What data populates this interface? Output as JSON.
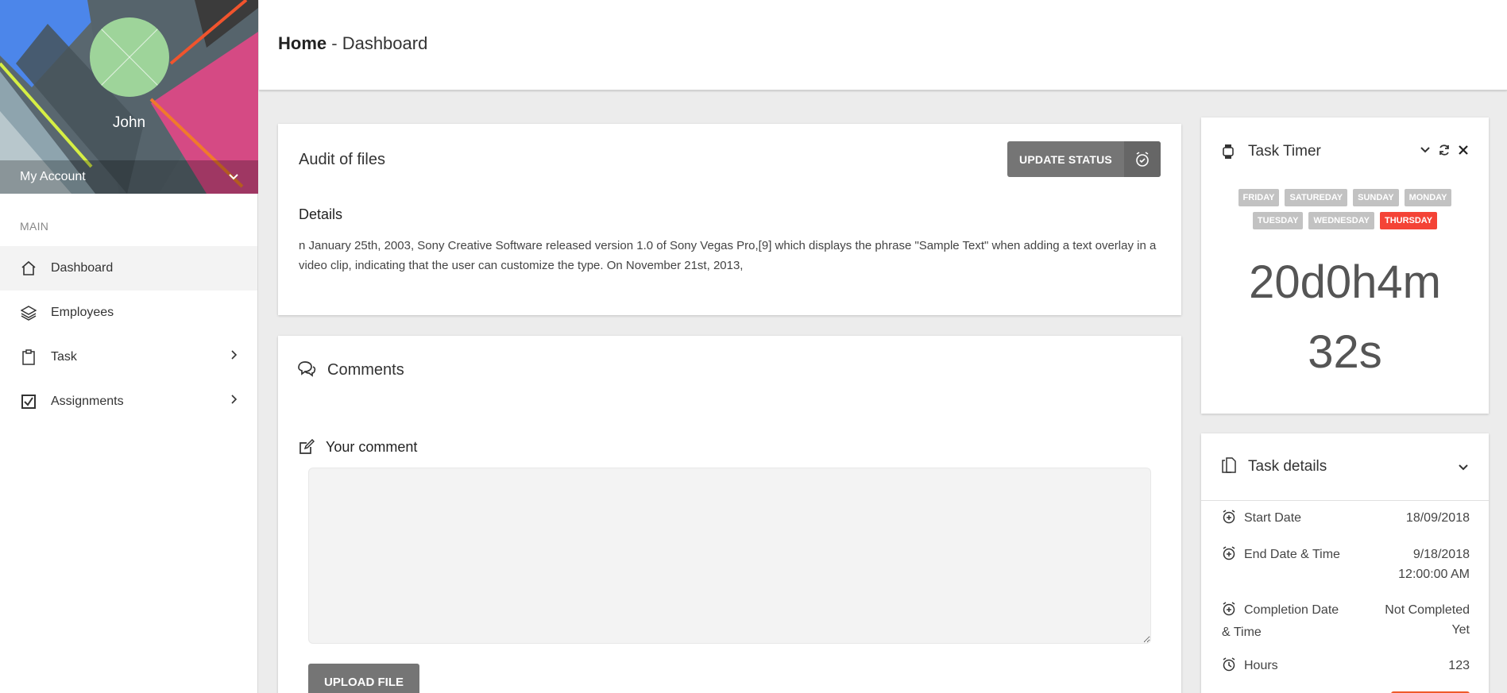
{
  "sidebar": {
    "user_name": "John",
    "account_label": "My Account",
    "section_label": "MAIN",
    "items": [
      {
        "label": "Dashboard"
      },
      {
        "label": "Employees"
      },
      {
        "label": "Task"
      },
      {
        "label": "Assignments"
      }
    ]
  },
  "header": {
    "home": "Home",
    "separator": "-",
    "page": "Dashboard"
  },
  "audit": {
    "title": "Audit of files",
    "update_button": "UPDATE STATUS",
    "details_heading": "Details",
    "details_text": "n January 25th, 2003, Sony Creative Software released version 1.0 of Sony Vegas Pro,[9] which displays the phrase \"Sample Text\" when adding a text overlay in a video clip, indicating that the user can customize the type. On November 21st, 2013,"
  },
  "comments": {
    "title": "Comments",
    "your_comment": "Your comment",
    "textarea_value": "",
    "upload_button": "UPLOAD FILE"
  },
  "timer": {
    "title": "Task Timer",
    "days": [
      "FRIDAY",
      "SATUREDAY",
      "SUNDAY",
      "MONDAY",
      "TUESDAY",
      "WEDNESDAY",
      "THURSDAY"
    ],
    "active_day": "THURSDAY",
    "clock_line1": "20d0h4m",
    "clock_line2": "32s"
  },
  "task_details": {
    "title": "Task details",
    "rows": [
      {
        "label": "Start Date",
        "value": "18/09/2018"
      },
      {
        "label": "End Date & Time",
        "value": "9/18/2018 12:00:00 AM"
      },
      {
        "label": "Completion Date & Time",
        "value": "Not Completed Yet"
      },
      {
        "label": "Hours",
        "value": "123"
      }
    ]
  },
  "colors": {
    "active_day": "#f44336",
    "button_gray": "#757575",
    "avatar_green": "#9ed49a",
    "accent_orange": "#ef5a2a"
  }
}
